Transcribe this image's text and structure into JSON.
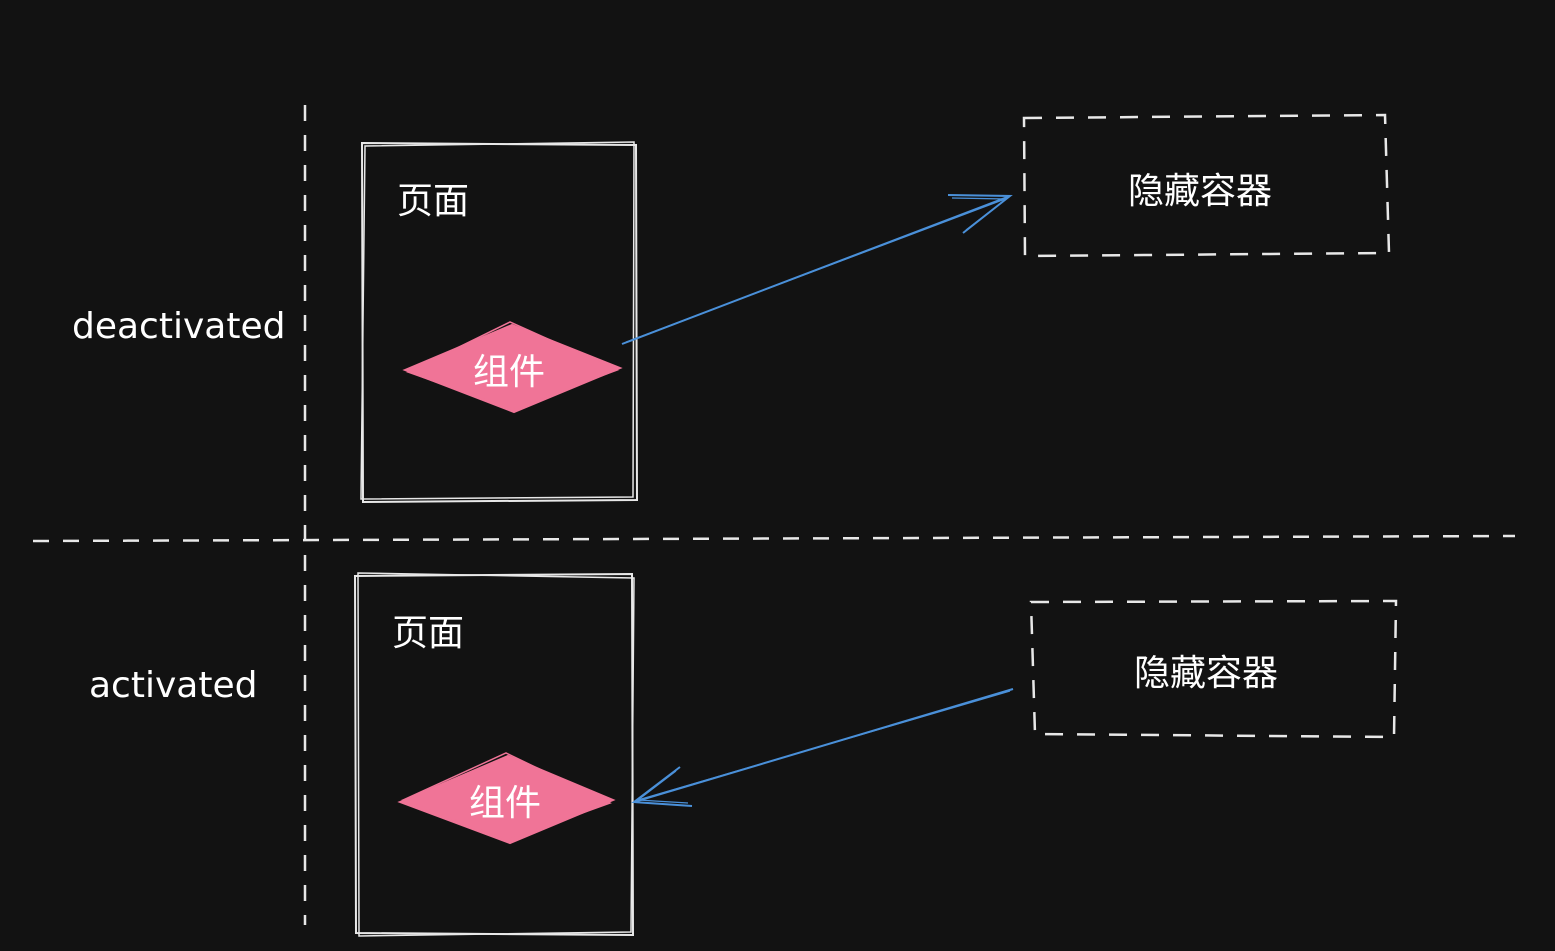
{
  "diagram": {
    "colors": {
      "background": "#121212",
      "stroke": "#e8e8e8",
      "component_fill": "#f07497",
      "arrow": "#4a90d9"
    },
    "states": [
      {
        "label": "deactivated",
        "page_label": "页面",
        "component_label": "组件",
        "container_label": "隐藏容器",
        "arrow_direction": "component-to-container"
      },
      {
        "label": "activated",
        "page_label": "页面",
        "component_label": "组件",
        "container_label": "隐藏容器",
        "arrow_direction": "container-to-component"
      }
    ]
  }
}
